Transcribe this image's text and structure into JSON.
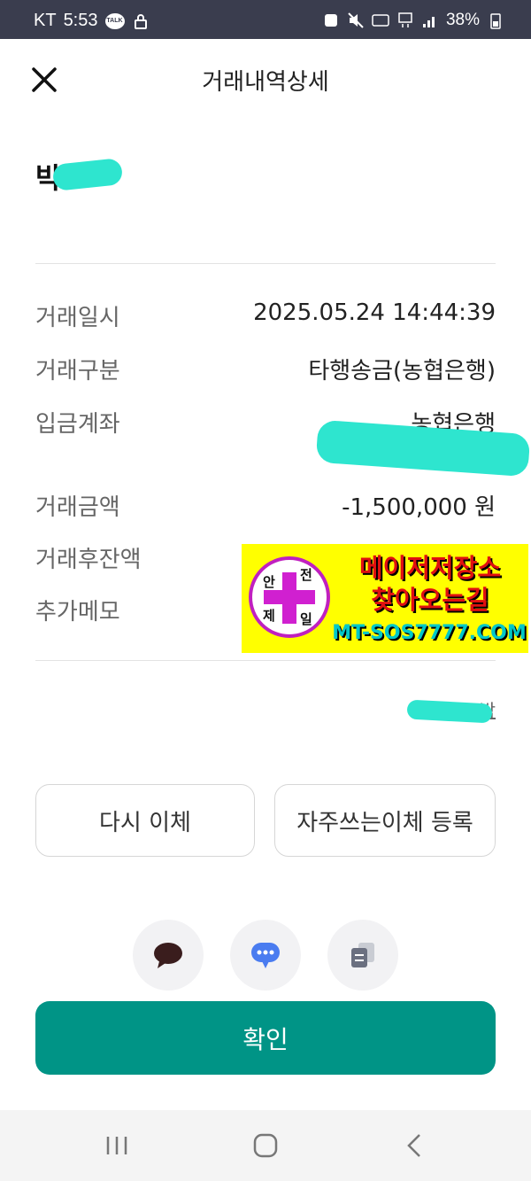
{
  "status_bar": {
    "carrier": "KT",
    "time": "5:53",
    "talk_badge": "TALK",
    "battery": "38%"
  },
  "header": {
    "title": "거래내역상세"
  },
  "recipient": {
    "name_visible": "박"
  },
  "details": [
    {
      "label": "거래일시",
      "value": "2025.05.24 14:44:39"
    },
    {
      "label": "거래구분",
      "value": "타행송금(농협은행)"
    },
    {
      "label": "입금계좌",
      "value": "농협은행"
    },
    {
      "label": "거래금액",
      "value": "-1,500,000 원"
    },
    {
      "label": "거래후잔액",
      "value": ""
    },
    {
      "label": "추가메모",
      "value": ""
    }
  ],
  "ad_overlay": {
    "logo_chars": [
      "안",
      "전",
      "제",
      "일"
    ],
    "line1": "메이저저장소",
    "line2": "찾아오는길",
    "line3": "MT-SOS7777.COM",
    "colors": {
      "background": "#ffff00",
      "headline": "#e01010",
      "url": "#00c8c8",
      "logo": "#d020d0"
    }
  },
  "search_link": "'박",
  "buttons": {
    "retransfer": "다시 이체",
    "register_frequent": "자주쓰는이체 등록",
    "confirm": "확인"
  },
  "icons": [
    "chat-bubble-icon",
    "message-icon",
    "copy-icon"
  ],
  "colors": {
    "accent": "#009486",
    "status_bar": "#3a3d4e",
    "redaction": "#2ee5cf",
    "message_icon": "#4a7cf0"
  }
}
